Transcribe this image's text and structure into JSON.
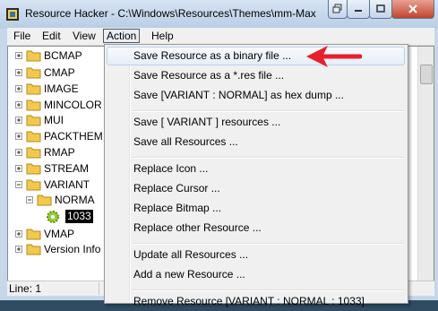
{
  "window": {
    "title": "Resource Hacker  -  C:\\Windows\\Resources\\Themes\\mm-Max"
  },
  "menubar": {
    "items": [
      "File",
      "Edit",
      "View",
      "Action",
      "Help"
    ]
  },
  "tree": {
    "items": [
      {
        "label": "BCMAP",
        "expander": "plus"
      },
      {
        "label": "CMAP",
        "expander": "plus"
      },
      {
        "label": "IMAGE",
        "expander": "plus"
      },
      {
        "label": "MINCOLOR",
        "expander": "plus"
      },
      {
        "label": "MUI",
        "expander": "plus"
      },
      {
        "label": "PACKTHEM",
        "expander": "plus"
      },
      {
        "label": "RMAP",
        "expander": "plus"
      },
      {
        "label": "STREAM",
        "expander": "plus"
      },
      {
        "label": "VARIANT",
        "expander": "minus"
      },
      {
        "label": "NORMA",
        "expander": "minus"
      },
      {
        "label": "1033",
        "expander": "none"
      },
      {
        "label": "VMAP",
        "expander": "plus"
      },
      {
        "label": "Version Info",
        "expander": "plus"
      }
    ]
  },
  "status": {
    "line": "Line: 1"
  },
  "action_menu": {
    "items": [
      "Save Resource as a binary file ...",
      "Save Resource as a *.res file ...",
      "Save [VARIANT : NORMAL] as hex dump ...",
      "Save [ VARIANT ] resources ...",
      "Save all Resources ...",
      "Replace Icon ...",
      "Replace Cursor ...",
      "Replace Bitmap ...",
      "Replace other Resource ...",
      "Update all Resources ...",
      "Add a new Resource ...",
      "Remove Resource [VARIANT : NORMAL : 1033]"
    ],
    "highlighted": "Save Resource as a binary file ..."
  },
  "colors": {
    "annotation_arrow": "#e8202a",
    "folder_yellow": "#f2c94c",
    "selection": "#000000"
  }
}
